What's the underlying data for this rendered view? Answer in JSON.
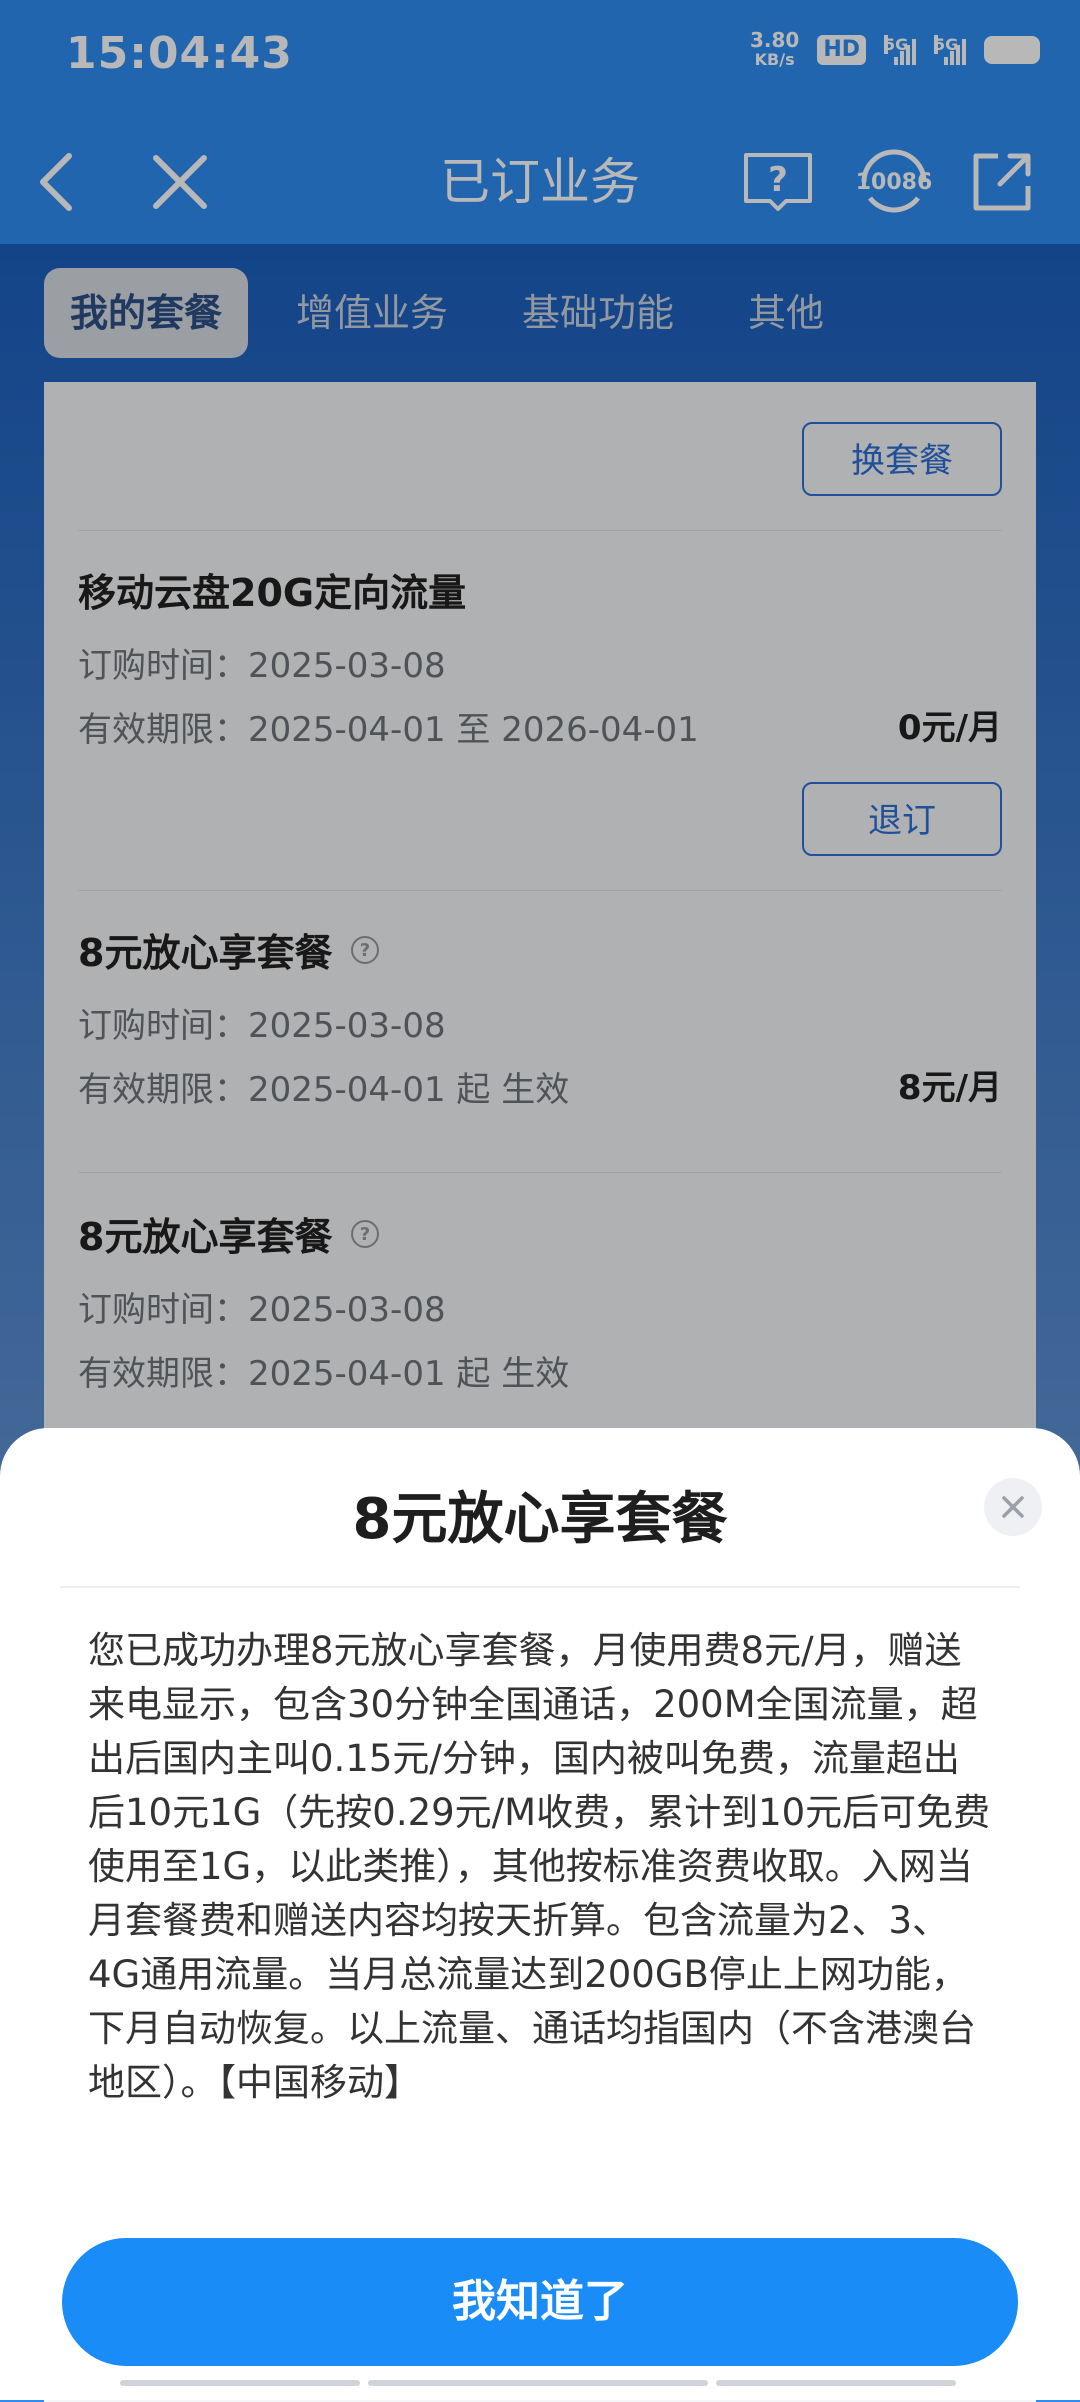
{
  "status_bar": {
    "time": "15:04:43",
    "net_speed_value": "3.80",
    "net_speed_unit": "KB/s",
    "hd_label": "HD",
    "signal1_label": "5G",
    "signal2_label": "5G"
  },
  "nav": {
    "title": "已订业务",
    "service_number": "10086"
  },
  "tabs": [
    {
      "label": "我的套餐",
      "active": true
    },
    {
      "label": "增值业务",
      "active": false
    },
    {
      "label": "基础功能",
      "active": false
    },
    {
      "label": "其他",
      "active": false
    }
  ],
  "actions": {
    "change_plan": "换套餐",
    "unsubscribe": "退订"
  },
  "subscriptions": [
    {
      "name": "移动云盘20G定向流量",
      "order_time": "订购时间：2025-03-08",
      "validity": "有效期限：2025-04-01 至 2026-04-01",
      "price": "0元/月"
    },
    {
      "name": "8元放心享套餐",
      "order_time": "订购时间：2025-03-08",
      "validity": "有效期限：2025-04-01 起 生效",
      "price": "8元/月"
    },
    {
      "name": "8元放心享套餐",
      "order_time": "订购时间：2025-03-08",
      "validity": "有效期限：2025-04-01 起 生效"
    }
  ],
  "sheet": {
    "title": "8元放心享套餐",
    "body": "您已成功办理8元放心享套餐，月使用费8元/月，赠送来电显示，包含30分钟全国通话，200M全国流量，超出后国内主叫0.15元/分钟，国内被叫免费，流量超出后10元1G（先按0.29元/M收费，累计到10元后可免费使用至1G，以此类推），其他按标准资费收取。入网当月套餐费和赠送内容均按天折算。包含流量为2、3、4G通用流量。当月总流量达到200GB停止上网功能，下月自动恢复。以上流量、通话均指国内（不含港澳台地区）。【中国移动】",
    "confirm_label": "我知道了"
  }
}
